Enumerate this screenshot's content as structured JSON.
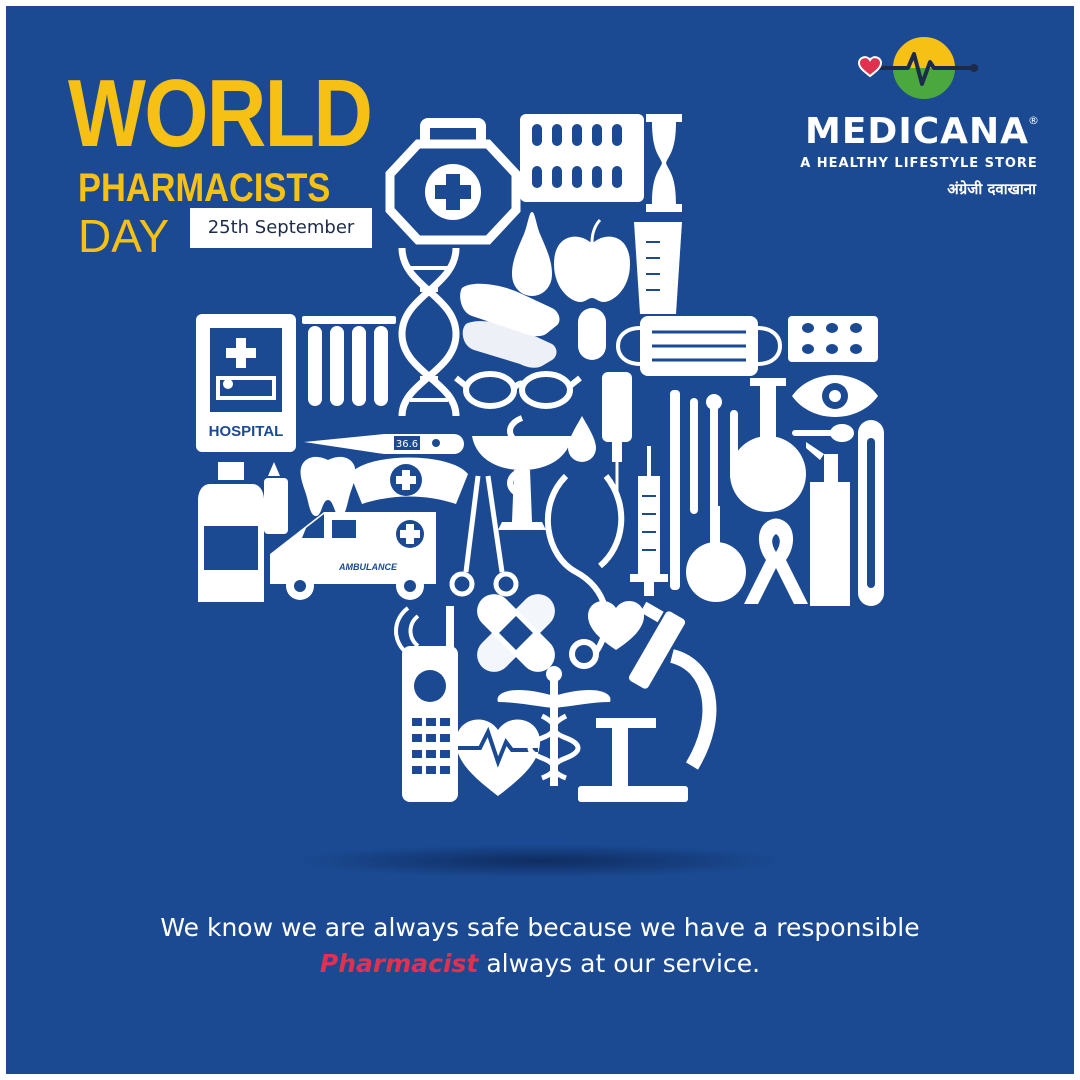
{
  "heading": {
    "line1": "WORLD",
    "line2": "PHARMACISTS",
    "line3": "DAY",
    "date": "25th September"
  },
  "brand": {
    "name": "MEDICANA",
    "registered": "®",
    "tagline": "A HEALTHY LIFESTYLE STORE",
    "hindi": "अंग्रेजी दवाखाना",
    "logo_icon": "heartbeat-globe-logo"
  },
  "illustration": {
    "hospital_label": "HOSPITAL",
    "ambulance_label": "AMBULANCE",
    "thermometer_reading": "36.6",
    "icons": [
      "first-aid-kit-icon",
      "pill-blister-icon",
      "hourglass-icon",
      "dna-icon",
      "gloves-icon",
      "apple-icon",
      "pear-icon",
      "measuring-cup-icon",
      "hospital-sign-icon",
      "test-tubes-icon",
      "capsule-icon",
      "face-mask-icon",
      "pill-strip-icon",
      "glasses-icon",
      "iv-bag-icon",
      "eye-icon",
      "thermometer-icon",
      "bowl-of-hygieia-icon",
      "flask-icon",
      "bottle-icon",
      "tooth-icon",
      "nurse-cap-icon",
      "ambulance-icon",
      "syringe-icon",
      "stethoscope-icon",
      "ribbon-icon",
      "spray-bottle-icon",
      "mercury-thermometer-icon",
      "walkie-talkie-icon",
      "bandage-icon",
      "heart-icon",
      "heartbeat-icon",
      "caduceus-icon",
      "microscope-icon"
    ]
  },
  "message": {
    "part1": "We know we are always safe because we have a responsible",
    "highlight": "Pharmacist",
    "part2": "always at our service."
  },
  "colors": {
    "background": "#1b4a93",
    "accent_yellow": "#f6c114",
    "highlight_red": "#e0314f",
    "text_white": "#ffffff"
  }
}
